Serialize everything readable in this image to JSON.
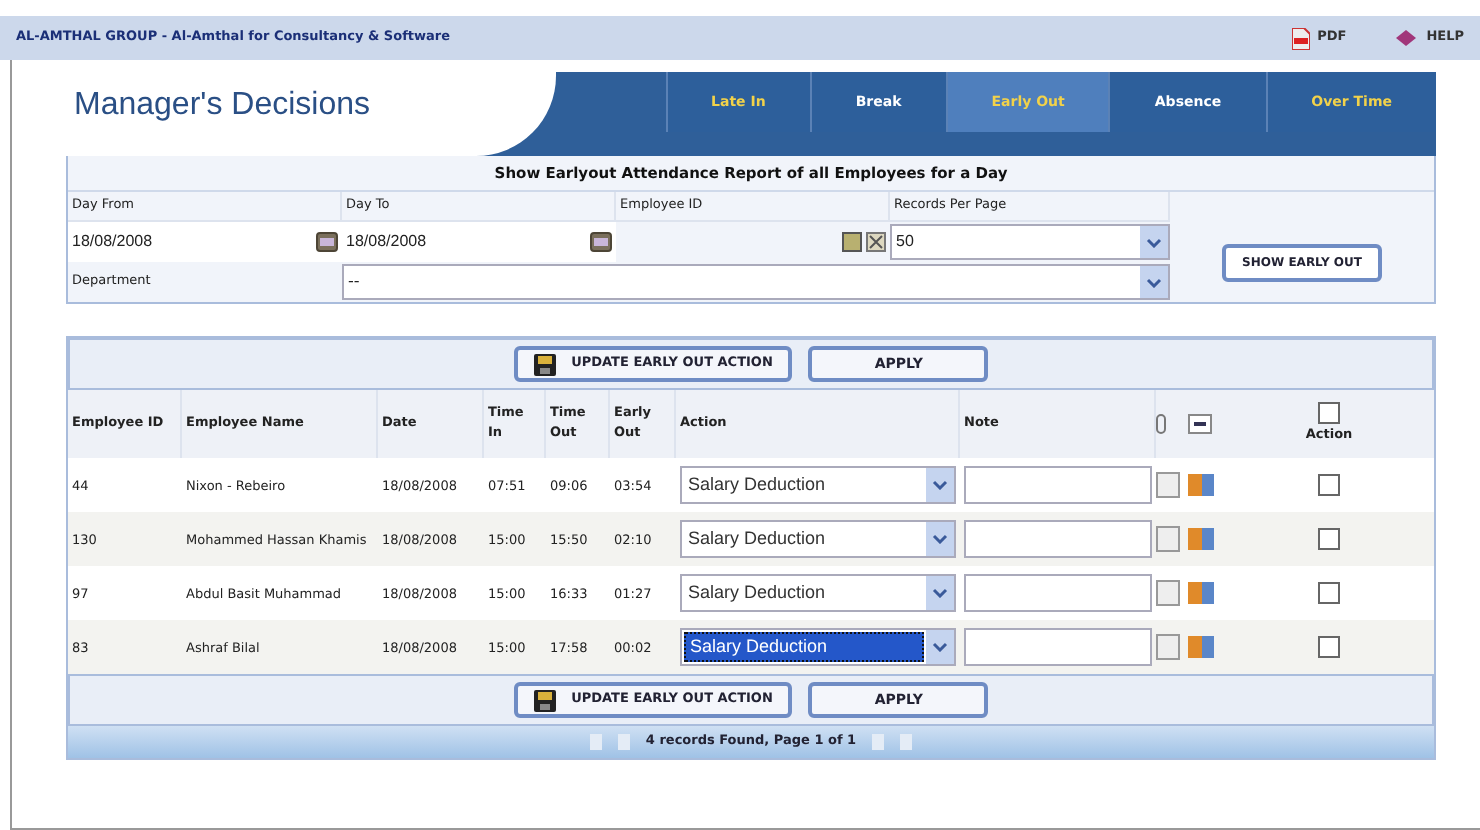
{
  "top_bar": {
    "title": "AL-AMTHAL GROUP - Al-Amthal for Consultancy & Software",
    "links": [
      {
        "label": "PDF",
        "kind": "pdf"
      },
      {
        "label": "HELP",
        "kind": "help"
      }
    ]
  },
  "header": {
    "title": "Manager's Decisions"
  },
  "tabs": [
    {
      "label": "Late In",
      "selected": false
    },
    {
      "label": "Break",
      "selected": false
    },
    {
      "label": "Early Out",
      "selected": true
    },
    {
      "label": "Absence",
      "selected": false
    },
    {
      "label": "Over Time",
      "selected": false
    }
  ],
  "form": {
    "heading": "Show Earlyout Attendance Report of all Employees for a Day",
    "day_from": {
      "label": "Day From",
      "value": "18/08/2008"
    },
    "day_to": {
      "label": "Day To",
      "value": "18/08/2008"
    },
    "employee_id": {
      "label": "Employee ID"
    },
    "records_per_page": {
      "label": "Records Per Page",
      "value": "50"
    },
    "department": {
      "label": "Department",
      "value": "--"
    },
    "submit": "SHOW EARLY OUT"
  },
  "action_bars": [
    {
      "update": "UPDATE EARLY OUT ACTION",
      "apply": "APPLY"
    },
    {
      "update": "UPDATE EARLY OUT ACTION",
      "apply": "APPLY"
    }
  ],
  "table": {
    "columns": [
      "Employee ID",
      "Employee Name",
      "Date",
      "Time In",
      "Time Out",
      "Early Out",
      "Action",
      "Note",
      "Action"
    ],
    "rows": [
      {
        "id": "44",
        "name": "Nixon - Rebeiro",
        "date": "18/08/2008",
        "time_in": "07:51",
        "time_out": "09:06",
        "early_out": "03:54",
        "action": "Salary Deduction",
        "focused": false,
        "checked": false
      },
      {
        "id": "130",
        "name": "Mohammed Hassan Khamis",
        "date": "18/08/2008",
        "time_in": "15:00",
        "time_out": "15:50",
        "early_out": "02:10",
        "action": "Salary Deduction",
        "focused": false,
        "checked": false
      },
      {
        "id": "97",
        "name": "Abdul Basit Muhammad",
        "date": "18/08/2008",
        "time_in": "15:00",
        "time_out": "16:33",
        "early_out": "01:27",
        "action": "Salary Deduction",
        "focused": false,
        "checked": false
      },
      {
        "id": "83",
        "name": "Ashraf Bilal",
        "date": "18/08/2008",
        "time_in": "15:00",
        "time_out": "17:58",
        "early_out": "00:02",
        "action": "Salary Deduction",
        "focused": true,
        "checked": false
      }
    ],
    "header_checked": false
  },
  "pagination": {
    "text": "4 records Found, Page 1 of 1"
  }
}
